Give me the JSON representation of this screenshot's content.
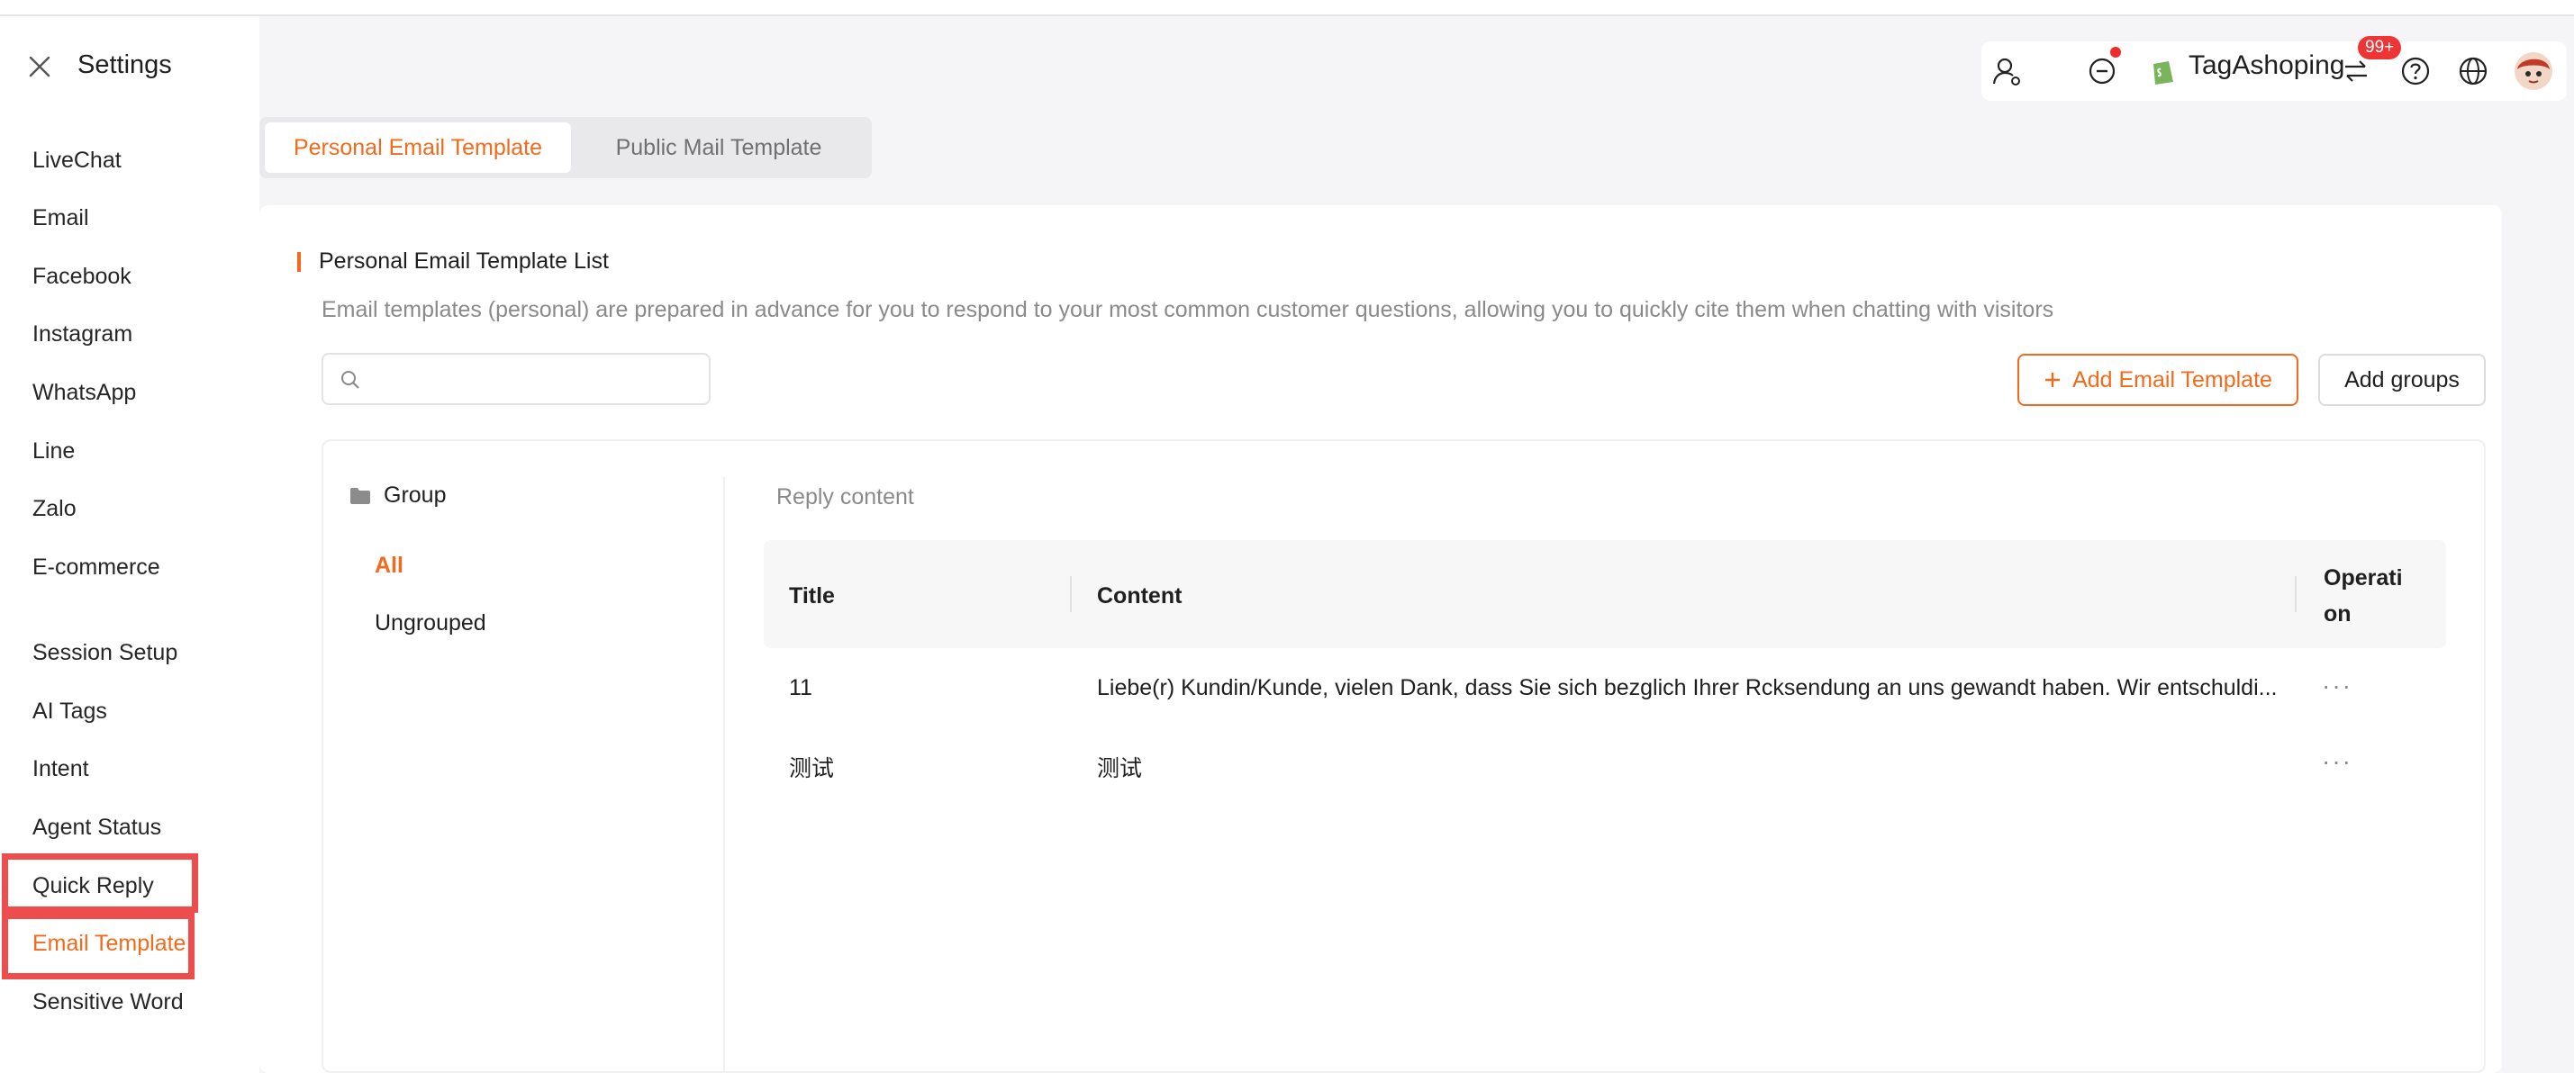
{
  "window": {
    "title": "Settings"
  },
  "sidebar": {
    "items": [
      {
        "label": "LiveChat"
      },
      {
        "label": "Email"
      },
      {
        "label": "Facebook"
      },
      {
        "label": "Instagram"
      },
      {
        "label": "WhatsApp"
      },
      {
        "label": "Line"
      },
      {
        "label": "Zalo"
      },
      {
        "label": "E-commerce"
      },
      {
        "label": "Session Setup"
      },
      {
        "label": "AI Tags"
      },
      {
        "label": "Intent"
      },
      {
        "label": "Agent Status"
      },
      {
        "label": "Quick Reply"
      },
      {
        "label": "Email Template",
        "active": true
      },
      {
        "label": "Sensitive Word"
      }
    ]
  },
  "header": {
    "store_name": "TagAshoping",
    "notification_badge": "99+",
    "icons": [
      "agent-icon",
      "status-icon",
      "shopify-icon",
      "switch-icon",
      "help-icon",
      "globe-icon",
      "avatar"
    ]
  },
  "tabs": [
    {
      "label": "Personal Email Template",
      "active": true
    },
    {
      "label": "Public Mail Template",
      "active": false
    }
  ],
  "main": {
    "title": "Personal Email Template List",
    "description": "Email templates (personal) are prepared in advance for you to respond to your most common customer questions, allowing you to quickly cite them when chatting with visitors",
    "search": {
      "value": "",
      "placeholder": ""
    },
    "add_button": "Add Email Template",
    "add_groups_button": "Add groups",
    "group": {
      "header": "Group",
      "items": [
        {
          "label": "All",
          "active": true
        },
        {
          "label": "Ungrouped",
          "active": false
        }
      ]
    },
    "reply_label": "Reply content",
    "table": {
      "columns": [
        "Title",
        "Content",
        "Operati",
        "on"
      ],
      "rows": [
        {
          "title": "11",
          "content": "Liebe(r) Kundin/Kunde, vielen Dank, dass Sie sich bezglich Ihrer Rcksendung an uns gewandt haben. Wir entschuldi...",
          "op": "···"
        },
        {
          "title": "测试",
          "content": "测试",
          "op": "···"
        }
      ]
    }
  },
  "colors": {
    "accent": "#f26a1b",
    "highlight": "#ee4d4d",
    "badge": "#ee3535"
  }
}
